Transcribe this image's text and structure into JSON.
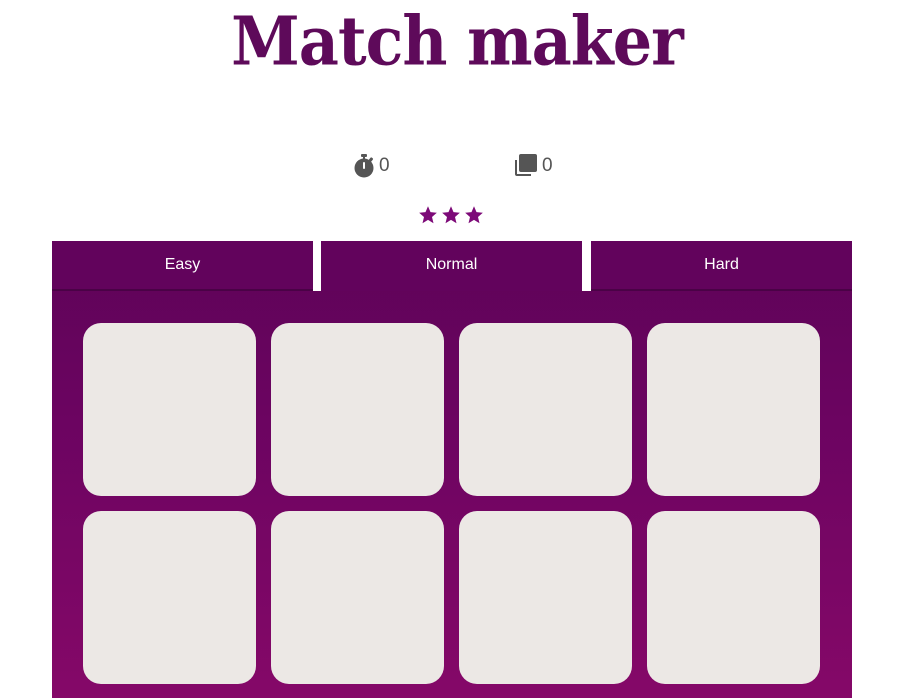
{
  "header": {
    "title": "Match maker"
  },
  "stats": {
    "timer_icon": "stopwatch-icon",
    "timer_value": "0",
    "moves_icon": "stacked-cards-icon",
    "moves_value": "0"
  },
  "rating": {
    "stars_filled": 3,
    "stars_total": 3,
    "star_color": "#7d0a78"
  },
  "difficulty_tabs": [
    {
      "label": "Easy",
      "active": false
    },
    {
      "label": "Normal",
      "active": true
    },
    {
      "label": "Hard",
      "active": false
    }
  ],
  "board": {
    "rows": 2,
    "columns": 4,
    "cards_face_down": 8,
    "card_color": "#ece8e5",
    "board_color_top": "#5e0358",
    "board_color_bottom": "#850868"
  },
  "colors": {
    "title": "#5e0a5a",
    "text": "#555555"
  }
}
